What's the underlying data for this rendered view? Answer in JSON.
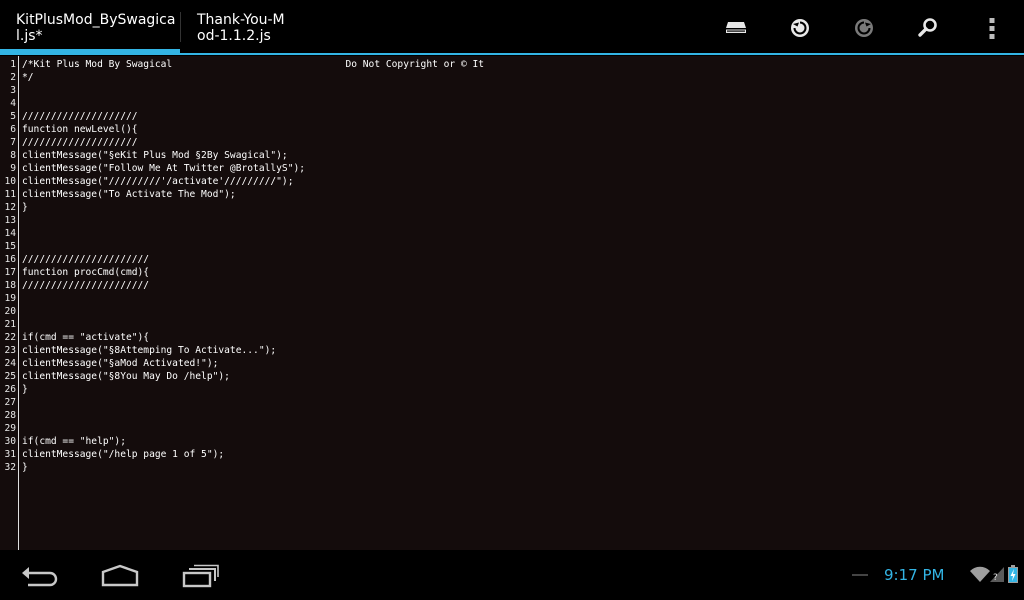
{
  "tabs": [
    {
      "label": "KitPlusMod_BySwagical.js*",
      "active": true
    },
    {
      "label": "Thank-You-Mod-1.1.2.js",
      "active": false
    }
  ],
  "toolbar": {
    "icons": [
      "save-icon",
      "undo-icon",
      "redo-icon",
      "search-icon",
      "overflow-menu-icon"
    ]
  },
  "editor": {
    "lines": [
      {
        "n": "1",
        "text": "/*Kit Plus Mod By Swagical                              Do Not Copyright or © It"
      },
      {
        "n": "2",
        "text": "*/"
      },
      {
        "n": "3",
        "text": ""
      },
      {
        "n": "4",
        "text": ""
      },
      {
        "n": "5",
        "text": "////////////////////"
      },
      {
        "n": "6",
        "text": "function newLevel(){"
      },
      {
        "n": "7",
        "text": "////////////////////"
      },
      {
        "n": "8",
        "text": "clientMessage(\"§eKit Plus Mod §2By Swagical\");"
      },
      {
        "n": "9",
        "text": "clientMessage(\"Follow Me At Twitter @BrotallyS\");"
      },
      {
        "n": "10",
        "text": "clientMessage(\"/////////'/activate'/////////\");"
      },
      {
        "n": "11",
        "text": "clientMessage(\"To Activate The Mod\");"
      },
      {
        "n": "12",
        "text": "}"
      },
      {
        "n": "13",
        "text": ""
      },
      {
        "n": "14",
        "text": ""
      },
      {
        "n": "15",
        "text": ""
      },
      {
        "n": "16",
        "text": "//////////////////////"
      },
      {
        "n": "17",
        "text": "function procCmd(cmd){"
      },
      {
        "n": "18",
        "text": "//////////////////////"
      },
      {
        "n": "19",
        "text": ""
      },
      {
        "n": "20",
        "text": ""
      },
      {
        "n": "21",
        "text": ""
      },
      {
        "n": "22",
        "text": "if(cmd == \"activate\"){"
      },
      {
        "n": "23",
        "text": "clientMessage(\"§8Attemping To Activate...\");"
      },
      {
        "n": "24",
        "text": "clientMessage(\"§aMod Activated!\");"
      },
      {
        "n": "25",
        "text": "clientMessage(\"§8You May Do /help\");"
      },
      {
        "n": "26",
        "text": "}"
      },
      {
        "n": "27",
        "text": ""
      },
      {
        "n": "28",
        "text": ""
      },
      {
        "n": "29",
        "text": ""
      },
      {
        "n": "30",
        "text": "if(cmd == \"help\");"
      },
      {
        "n": "31",
        "text": "clientMessage(\"/help page 1 of 5\");"
      },
      {
        "n": "32",
        "text": "}"
      }
    ]
  },
  "navbar": {
    "icons": [
      "back-icon",
      "home-icon",
      "recent-apps-icon"
    ]
  },
  "status": {
    "time": "9:17 PM",
    "icons": [
      "wifi-icon",
      "signal-icon",
      "battery-charging-icon"
    ]
  },
  "colors": {
    "accent": "#33b5e5",
    "editor_bg": "#140c0c",
    "text": "#ffffff"
  }
}
